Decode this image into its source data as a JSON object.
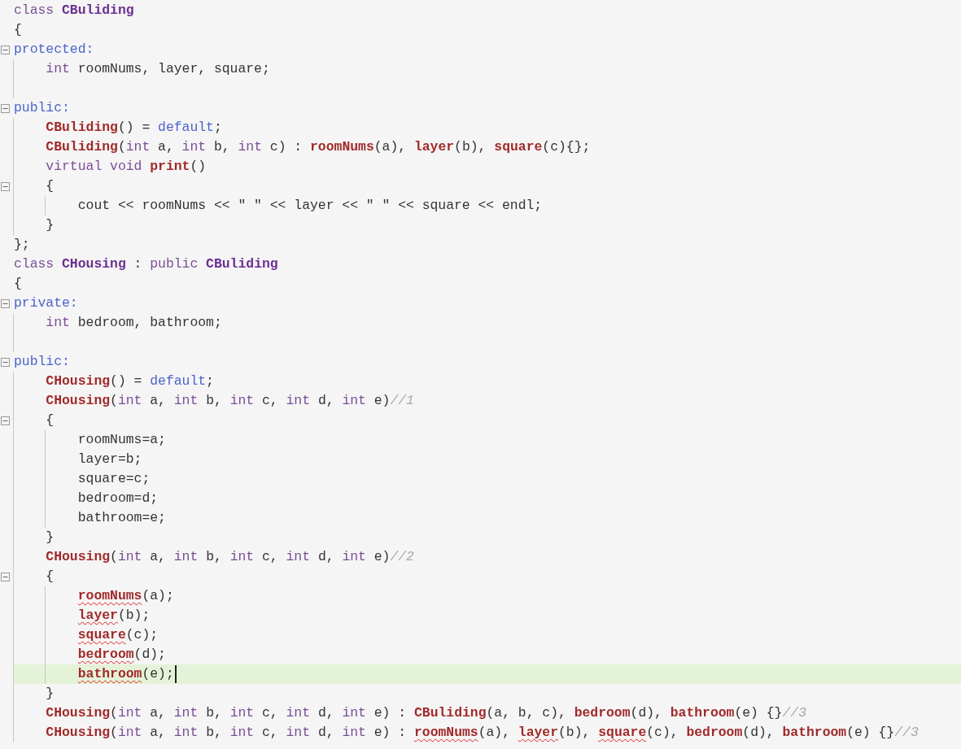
{
  "editor": {
    "lines": [
      {
        "fold": false,
        "current": false,
        "tokens": [
          {
            "kind": "keyword",
            "text": "class "
          },
          {
            "kind": "type",
            "text": "CBuliding"
          }
        ]
      },
      {
        "fold": false,
        "current": false,
        "tokens": [
          {
            "kind": "plain",
            "text": "{"
          }
        ]
      },
      {
        "fold": true,
        "current": false,
        "tokens": [
          {
            "kind": "access",
            "text": "protected:"
          }
        ],
        "children": [
          {
            "fold": false,
            "current": false,
            "tokens": [
              {
                "kind": "keyword",
                "text": "int"
              },
              {
                "kind": "plain",
                "text": " roomNums, layer, square;"
              }
            ]
          },
          {
            "fold": false,
            "current": false
          }
        ]
      },
      {
        "fold": true,
        "current": false,
        "tokens": [
          {
            "kind": "access",
            "text": "public:"
          }
        ],
        "children": [
          {
            "fold": false,
            "current": false,
            "tokens": [
              {
                "kind": "func",
                "text": "CBuliding"
              },
              {
                "kind": "plain",
                "text": "() = "
              },
              {
                "kind": "access",
                "text": "default"
              },
              {
                "kind": "plain",
                "text": ";"
              }
            ]
          },
          {
            "fold": false,
            "current": false,
            "tokens": [
              {
                "kind": "func",
                "text": "CBuliding"
              },
              {
                "kind": "plain",
                "text": "("
              },
              {
                "kind": "keyword",
                "text": "int"
              },
              {
                "kind": "plain",
                "text": " a, "
              },
              {
                "kind": "keyword",
                "text": "int"
              },
              {
                "kind": "plain",
                "text": " b, "
              },
              {
                "kind": "keyword",
                "text": "int"
              },
              {
                "kind": "plain",
                "text": " c) : "
              },
              {
                "kind": "func",
                "text": "roomNums"
              },
              {
                "kind": "plain",
                "text": "(a), "
              },
              {
                "kind": "func",
                "text": "layer"
              },
              {
                "kind": "plain",
                "text": "(b), "
              },
              {
                "kind": "func",
                "text": "square"
              },
              {
                "kind": "plain",
                "text": "(c){};"
              }
            ]
          },
          {
            "fold": false,
            "current": false,
            "tokens": [
              {
                "kind": "keyword",
                "text": "virtual void "
              },
              {
                "kind": "func",
                "text": "print"
              },
              {
                "kind": "plain",
                "text": "()"
              }
            ]
          },
          {
            "fold": true,
            "current": false,
            "tokens": [
              {
                "kind": "plain",
                "text": "{"
              }
            ],
            "children": [
              {
                "fold": false,
                "current": false,
                "tokens": [
                  {
                    "kind": "plain",
                    "text": "cout << roomNums << \" \" << layer << \" \" << square << endl;"
                  }
                ]
              }
            ]
          },
          {
            "fold": false,
            "current": false,
            "tokens": [
              {
                "kind": "plain",
                "text": "}"
              }
            ]
          }
        ]
      },
      {
        "fold": false,
        "current": false,
        "tokens": [
          {
            "kind": "plain",
            "text": "};"
          }
        ]
      },
      {
        "fold": false,
        "current": false,
        "tokens": [
          {
            "kind": "keyword",
            "text": "class "
          },
          {
            "kind": "type",
            "text": "CHousing"
          },
          {
            "kind": "plain",
            "text": " : "
          },
          {
            "kind": "keyword",
            "text": "public "
          },
          {
            "kind": "type",
            "text": "CBuliding"
          }
        ]
      },
      {
        "fold": false,
        "current": false,
        "tokens": [
          {
            "kind": "plain",
            "text": "{"
          }
        ]
      },
      {
        "fold": true,
        "current": false,
        "tokens": [
          {
            "kind": "access",
            "text": "private:"
          }
        ],
        "children": [
          {
            "fold": false,
            "current": false,
            "tokens": [
              {
                "kind": "keyword",
                "text": "int"
              },
              {
                "kind": "plain",
                "text": " bedroom, bathroom;"
              }
            ]
          },
          {
            "fold": false,
            "current": false
          }
        ]
      },
      {
        "fold": true,
        "current": false,
        "tokens": [
          {
            "kind": "access",
            "text": "public:"
          }
        ],
        "children": [
          {
            "fold": false,
            "current": false,
            "tokens": [
              {
                "kind": "func",
                "text": "CHousing"
              },
              {
                "kind": "plain",
                "text": "() = "
              },
              {
                "kind": "access",
                "text": "default"
              },
              {
                "kind": "plain",
                "text": ";"
              }
            ]
          },
          {
            "fold": false,
            "current": false,
            "tokens": [
              {
                "kind": "func",
                "text": "CHousing"
              },
              {
                "kind": "plain",
                "text": "("
              },
              {
                "kind": "keyword",
                "text": "int"
              },
              {
                "kind": "plain",
                "text": " a, "
              },
              {
                "kind": "keyword",
                "text": "int"
              },
              {
                "kind": "plain",
                "text": " b, "
              },
              {
                "kind": "keyword",
                "text": "int"
              },
              {
                "kind": "plain",
                "text": " c, "
              },
              {
                "kind": "keyword",
                "text": "int"
              },
              {
                "kind": "plain",
                "text": " d, "
              },
              {
                "kind": "keyword",
                "text": "int"
              },
              {
                "kind": "plain",
                "text": " e)"
              },
              {
                "kind": "comment",
                "text": "//1"
              }
            ]
          },
          {
            "fold": true,
            "current": false,
            "tokens": [
              {
                "kind": "plain",
                "text": "{"
              }
            ],
            "children": [
              {
                "fold": false,
                "current": false,
                "tokens": [
                  {
                    "kind": "plain",
                    "text": "roomNums=a;"
                  }
                ]
              },
              {
                "fold": false,
                "current": false,
                "tokens": [
                  {
                    "kind": "plain",
                    "text": "layer=b;"
                  }
                ]
              },
              {
                "fold": false,
                "current": false,
                "tokens": [
                  {
                    "kind": "plain",
                    "text": "square=c;"
                  }
                ]
              },
              {
                "fold": false,
                "current": false,
                "tokens": [
                  {
                    "kind": "plain",
                    "text": "bedroom=d;"
                  }
                ]
              },
              {
                "fold": false,
                "current": false,
                "tokens": [
                  {
                    "kind": "plain",
                    "text": "bathroom=e;"
                  }
                ]
              }
            ]
          },
          {
            "fold": false,
            "current": false,
            "tokens": [
              {
                "kind": "plain",
                "text": "}"
              }
            ]
          },
          {
            "fold": false,
            "current": false,
            "tokens": [
              {
                "kind": "func",
                "text": "CHousing"
              },
              {
                "kind": "plain",
                "text": "("
              },
              {
                "kind": "keyword",
                "text": "int"
              },
              {
                "kind": "plain",
                "text": " a, "
              },
              {
                "kind": "keyword",
                "text": "int"
              },
              {
                "kind": "plain",
                "text": " b, "
              },
              {
                "kind": "keyword",
                "text": "int"
              },
              {
                "kind": "plain",
                "text": " c, "
              },
              {
                "kind": "keyword",
                "text": "int"
              },
              {
                "kind": "plain",
                "text": " d, "
              },
              {
                "kind": "keyword",
                "text": "int"
              },
              {
                "kind": "plain",
                "text": " e)"
              },
              {
                "kind": "comment",
                "text": "//2"
              }
            ]
          },
          {
            "fold": true,
            "current": false,
            "tokens": [
              {
                "kind": "plain",
                "text": "{"
              }
            ],
            "children": [
              {
                "fold": false,
                "current": false,
                "tokens": [
                  {
                    "kind": "unresolved",
                    "text": "roomNums"
                  },
                  {
                    "kind": "plain",
                    "text": "(a);"
                  }
                ]
              },
              {
                "fold": false,
                "current": false,
                "tokens": [
                  {
                    "kind": "unresolved",
                    "text": "layer"
                  },
                  {
                    "kind": "plain",
                    "text": "(b);"
                  }
                ]
              },
              {
                "fold": false,
                "current": false,
                "tokens": [
                  {
                    "kind": "unresolved",
                    "text": "square"
                  },
                  {
                    "kind": "plain",
                    "text": "(c);"
                  }
                ]
              },
              {
                "fold": false,
                "current": false,
                "tokens": [
                  {
                    "kind": "unresolved",
                    "text": "bedroom"
                  },
                  {
                    "kind": "plain",
                    "text": "(d);"
                  }
                ]
              },
              {
                "fold": false,
                "current": true,
                "tokens": [
                  {
                    "kind": "unresolved",
                    "text": "bathroom"
                  },
                  {
                    "kind": "plain",
                    "text": "(e);"
                  }
                ]
              }
            ]
          },
          {
            "fold": false,
            "current": false,
            "tokens": [
              {
                "kind": "plain",
                "text": "}"
              }
            ]
          },
          {
            "fold": false,
            "current": false,
            "tokens": [
              {
                "kind": "func",
                "text": "CHousing"
              },
              {
                "kind": "plain",
                "text": "("
              },
              {
                "kind": "keyword",
                "text": "int"
              },
              {
                "kind": "plain",
                "text": " a, "
              },
              {
                "kind": "keyword",
                "text": "int"
              },
              {
                "kind": "plain",
                "text": " b, "
              },
              {
                "kind": "keyword",
                "text": "int"
              },
              {
                "kind": "plain",
                "text": " c, "
              },
              {
                "kind": "keyword",
                "text": "int"
              },
              {
                "kind": "plain",
                "text": " d, "
              },
              {
                "kind": "keyword",
                "text": "int"
              },
              {
                "kind": "plain",
                "text": " e) : "
              },
              {
                "kind": "func",
                "text": "CBuliding"
              },
              {
                "kind": "plain",
                "text": "(a, b, c), "
              },
              {
                "kind": "func",
                "text": "bedroom"
              },
              {
                "kind": "plain",
                "text": "(d), "
              },
              {
                "kind": "func",
                "text": "bathroom"
              },
              {
                "kind": "plain",
                "text": "(e) {}"
              },
              {
                "kind": "comment",
                "text": "//3"
              }
            ]
          },
          {
            "fold": false,
            "current": false,
            "tokens": [
              {
                "kind": "func",
                "text": "CHousing"
              },
              {
                "kind": "plain",
                "text": "("
              },
              {
                "kind": "keyword",
                "text": "int"
              },
              {
                "kind": "plain",
                "text": " a, "
              },
              {
                "kind": "keyword",
                "text": "int"
              },
              {
                "kind": "plain",
                "text": " b, "
              },
              {
                "kind": "keyword",
                "text": "int"
              },
              {
                "kind": "plain",
                "text": " c, "
              },
              {
                "kind": "keyword",
                "text": "int"
              },
              {
                "kind": "plain",
                "text": " d, "
              },
              {
                "kind": "keyword",
                "text": "int"
              },
              {
                "kind": "plain",
                "text": " e) : "
              },
              {
                "kind": "unresolved",
                "text": "roomNums"
              },
              {
                "kind": "plain",
                "text": "(a), "
              },
              {
                "kind": "unresolved",
                "text": "layer"
              },
              {
                "kind": "plain",
                "text": "(b), "
              },
              {
                "kind": "unresolved",
                "text": "square"
              },
              {
                "kind": "plain",
                "text": "(c), "
              },
              {
                "kind": "func",
                "text": "bedroom"
              },
              {
                "kind": "plain",
                "text": "(d), "
              },
              {
                "kind": "func",
                "text": "bathroom"
              },
              {
                "kind": "plain",
                "text": "(e) {}"
              },
              {
                "kind": "comment",
                "text": "//3"
              }
            ]
          }
        ]
      }
    ]
  }
}
